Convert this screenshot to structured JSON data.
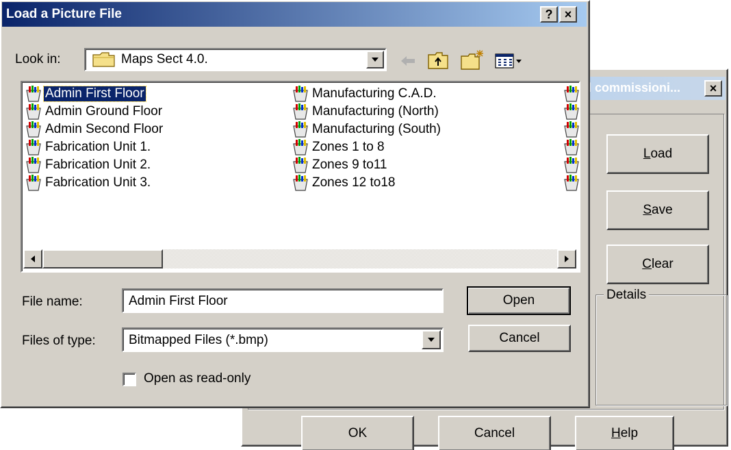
{
  "bg_dialog": {
    "title": "l commissioni...",
    "close_glyph": "×",
    "buttons": {
      "load": "Load",
      "save": "Save",
      "clear": "Clear"
    },
    "details_label": "Details",
    "footer": {
      "ok": "OK",
      "cancel": "Cancel",
      "help": "Help"
    }
  },
  "dialog": {
    "title": "Load a Picture File",
    "help_glyph": "?",
    "close_glyph": "×",
    "look_in": {
      "label": "Look in:",
      "value": "Maps Sect 4.0."
    },
    "files": [
      "Admin First Floor",
      "Admin Ground Floor",
      "Admin Second Floor",
      "Fabrication Unit 1.",
      "Fabrication Unit 2.",
      "Fabrication Unit 3.",
      "Manufacturing C.A.D.",
      "Manufacturing (North)",
      "Manufacturing (South)",
      "Zones 1 to 8",
      "Zones 9 to11",
      "Zones 12 to18"
    ],
    "selected_file": "Admin First Floor",
    "file_name": {
      "label": "File name:",
      "value": "Admin First Floor"
    },
    "file_type": {
      "label": "Files of type:",
      "value": "Bitmapped Files (*.bmp)"
    },
    "read_only": {
      "label": "Open as read-only",
      "checked": false
    },
    "open_label": "Open",
    "cancel_label": "Cancel"
  },
  "colors": {
    "titlebar_start": "#0a246a",
    "titlebar_end": "#a6caf0",
    "face": "#d4d0c8",
    "selection": "#0a246a"
  },
  "icons": [
    "folder-icon",
    "back-arrow-icon",
    "up-folder-icon",
    "new-folder-icon",
    "view-menu-icon",
    "picture-file-icon",
    "dropdown-arrow-icon",
    "scroll-left-icon",
    "scroll-right-icon",
    "close-icon",
    "help-icon"
  ]
}
